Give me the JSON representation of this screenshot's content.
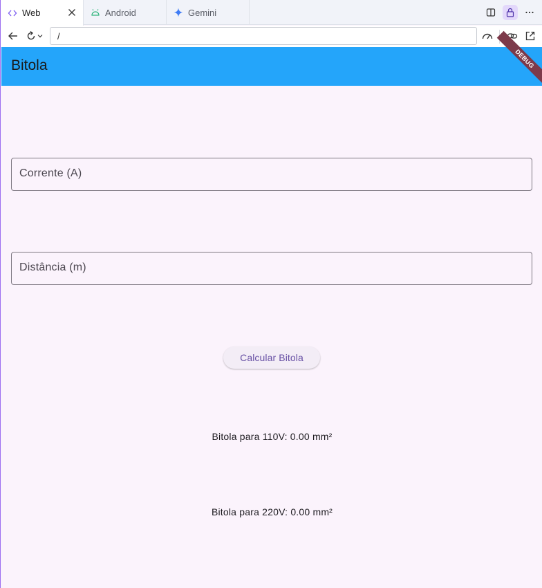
{
  "browser": {
    "tabs": [
      {
        "label": "Web",
        "icon": "code-icon",
        "active": true
      },
      {
        "label": "Android",
        "icon": "android-icon",
        "active": false
      },
      {
        "label": "Gemini",
        "icon": "gemini-sparkle-icon",
        "active": false
      }
    ],
    "url": "/",
    "accent_color": "#9b6cf0"
  },
  "app": {
    "title": "Bitola",
    "debug_banner": "DEBUG",
    "appbar_color": "#24a5fa",
    "fields": {
      "current_label": "Corrente (A)",
      "distance_label": "Distância (m)"
    },
    "calculate_button": "Calcular Bitola",
    "results": {
      "r110": "Bitola para 110V: 0.00 mm²",
      "r220": "Bitola para 220V: 0.00 mm²"
    }
  }
}
